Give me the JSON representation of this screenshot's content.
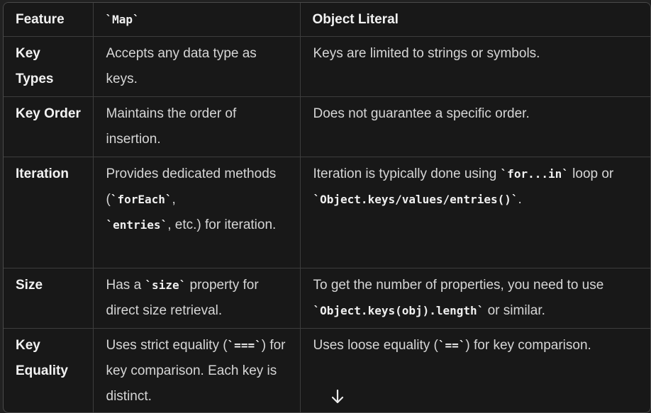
{
  "table": {
    "headers": {
      "feature": "Feature",
      "map": "`Map`",
      "object": "Object Literal"
    },
    "rows": [
      {
        "feature": "Key Types",
        "map": "Accepts any data type as keys.",
        "object": "Keys are limited to strings or symbols."
      },
      {
        "feature": "Key Order",
        "map": "Maintains the order of insertion.",
        "object": "Does not guarantee a specific order."
      },
      {
        "feature": "Iteration",
        "map_parts": {
          "a": "Provides dedicated methods (",
          "b": "`forEach`",
          "c": ", ",
          "d": "`entries`",
          "e": ", etc.) for iteration."
        },
        "object_parts": {
          "a": "Iteration is typically done using ",
          "b": "`for...in`",
          "c": " loop or ",
          "d": "`Object.keys/values/entries()`",
          "e": "."
        }
      },
      {
        "feature": "Size",
        "map_parts": {
          "a": "Has a ",
          "b": "`size`",
          "c": " property for direct size retrieval."
        },
        "object_parts": {
          "a": "To get the number of properties, you need to use ",
          "b": "`Object.keys(obj).length`",
          "c": " or similar."
        }
      },
      {
        "feature": "Key Equality",
        "map_parts": {
          "a": "Uses strict equality (",
          "b": "`===`",
          "c": ") for key comparison. Each key is distinct."
        },
        "object_parts": {
          "a": "Uses loose equality (",
          "b": "`==`",
          "c": ") for key comparison."
        }
      }
    ]
  },
  "scroll_button": {
    "icon": "arrow-down-icon"
  },
  "colors": {
    "background": "#212121",
    "table_background": "#181818",
    "border": "#3d3d3d",
    "text": "#d6d6d6",
    "header_text": "#f2f2f2"
  }
}
